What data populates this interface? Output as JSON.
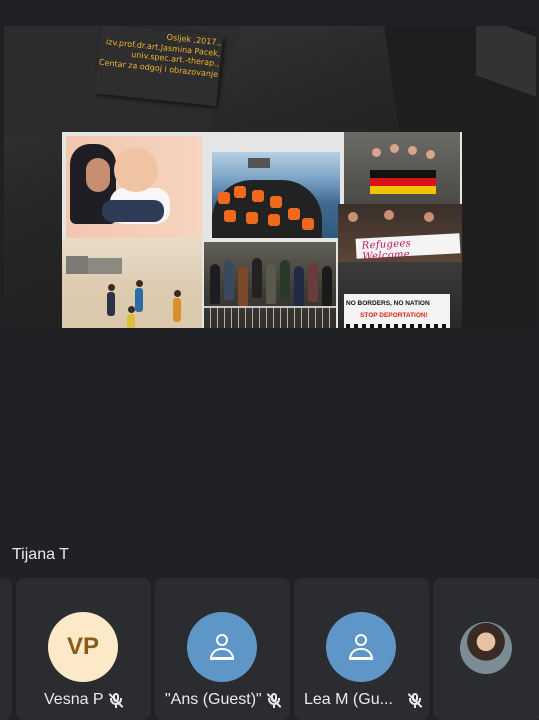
{
  "slide": {
    "caption_lines": [
      "Osijek ,2017.,",
      "izv.prof.dr.art.Jasmina Pacek,",
      "univ.spec.art.-therap.,",
      "Centar za odgoj i obrazovanje"
    ],
    "banner_refugees": "Refugees Welcome",
    "banner_no_borders": "NO BORDERS, NO NATION",
    "banner_stop": "STOP DEPORTATION!"
  },
  "speaker": {
    "name": "Tijana T"
  },
  "participants": [
    {
      "name": "Vesna P",
      "initials": "VP",
      "avatar": "initials",
      "muted": true
    },
    {
      "name": "\"Ans (Guest)\"",
      "avatar": "person-icon",
      "muted": true
    },
    {
      "name": "Lea M (Gu...",
      "avatar": "person-icon",
      "muted": true
    },
    {
      "name": "",
      "avatar": "photo",
      "muted": false
    }
  ],
  "colors": {
    "background": "#202124",
    "tile": "#2b2c2f",
    "caption": "#f2b233",
    "avatar_generic": "#5e97c7",
    "avatar_initials_bg": "#fbe9c8"
  },
  "icons": {
    "muted": "mic-off-icon",
    "generic_avatar": "person-icon"
  }
}
